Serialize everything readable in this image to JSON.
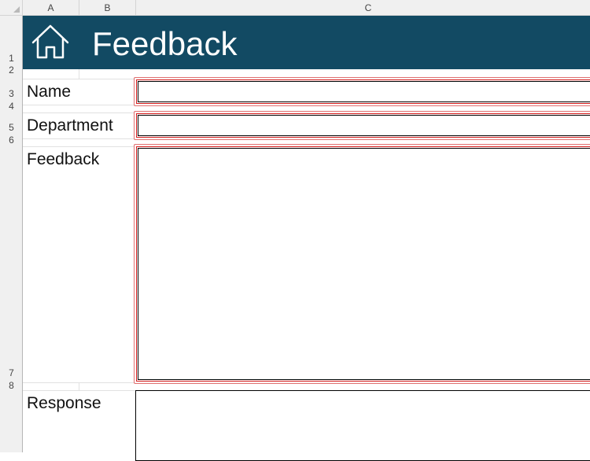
{
  "columns": [
    "A",
    "B",
    "C"
  ],
  "rows": [
    "1",
    "2",
    "3",
    "4",
    "5",
    "6",
    "7",
    "8"
  ],
  "banner": {
    "title": "Feedback",
    "icon": "home-icon",
    "color": "#124a63"
  },
  "form": {
    "name_label": "Name",
    "department_label": "Department",
    "feedback_label": "Feedback",
    "response_label": "Response",
    "name_value": "",
    "department_value": "",
    "feedback_value": "",
    "response_value": ""
  },
  "colors": {
    "field_border": "#d41b1b"
  }
}
